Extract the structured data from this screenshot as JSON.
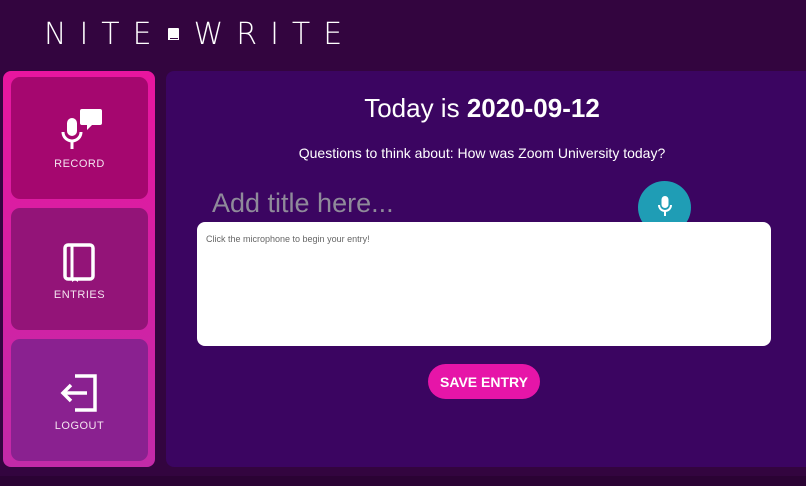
{
  "app": {
    "logo_left": "NITE",
    "logo_right": "WRITE"
  },
  "sidebar": {
    "items": [
      {
        "label": "RECORD",
        "icon": "microphone-speech-icon"
      },
      {
        "label": "ENTRIES",
        "icon": "notebook-icon"
      },
      {
        "label": "LOGOUT",
        "icon": "logout-arrow-icon"
      }
    ]
  },
  "main": {
    "today_prefix": "Today is",
    "date": "2020-09-12",
    "question": "Questions to think about: How was Zoom University today?",
    "title_placeholder": "Add title here...",
    "entry_placeholder": "Click the microphone to begin your entry!",
    "save_label": "SAVE ENTRY"
  },
  "colors": {
    "background": "#33053f",
    "panel": "#3b0561",
    "sidebar_accent": "#e8169f",
    "mic_button": "#1f9db5",
    "save_button": "#e615a8"
  }
}
